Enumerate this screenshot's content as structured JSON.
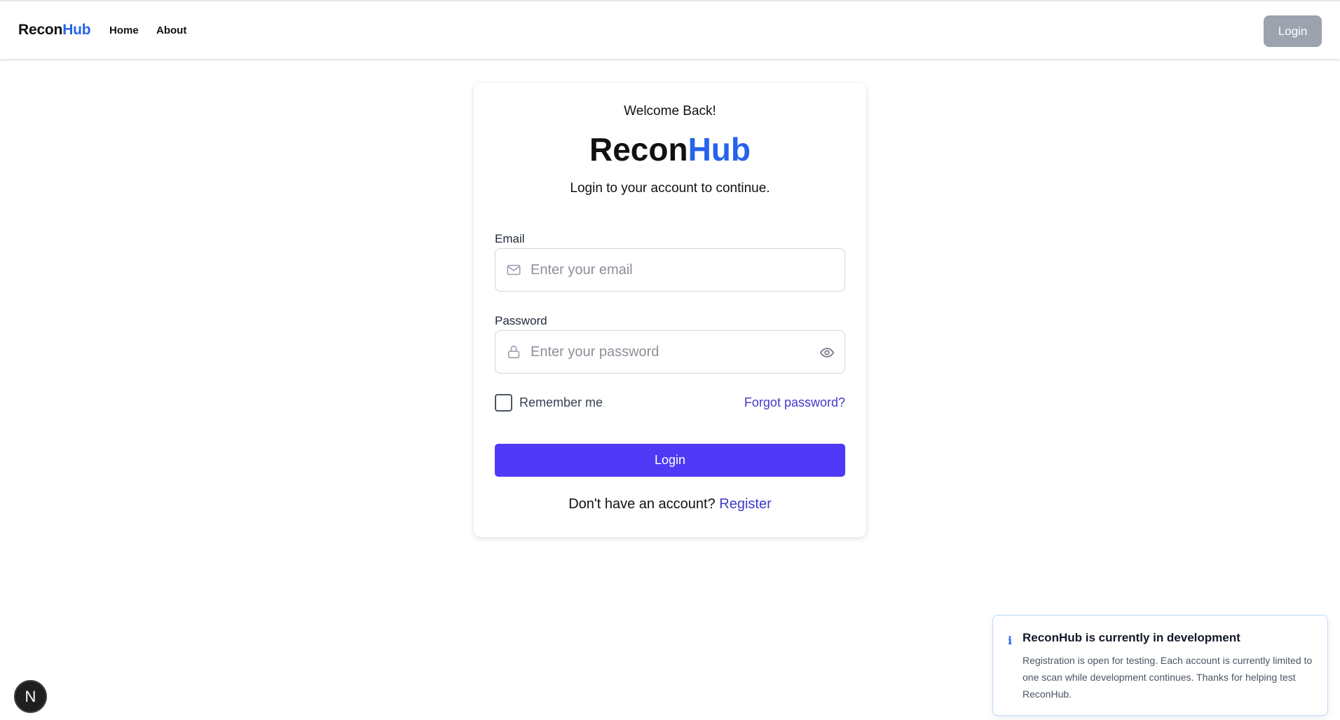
{
  "nav": {
    "brand_part1": "Recon",
    "brand_part2": "Hub",
    "links": [
      "Home",
      "About"
    ],
    "login_label": "Login"
  },
  "card": {
    "welcome": "Welcome Back!",
    "brand_part1": "Recon",
    "brand_part2": "Hub",
    "subtitle": "Login to your account to continue.",
    "email_label": "Email",
    "email_placeholder": "Enter your email",
    "password_label": "Password",
    "password_placeholder": "Enter your password",
    "remember_label": "Remember me",
    "remember_checked": false,
    "forgot_label": "Forgot password?",
    "login_label": "Login",
    "no_account_text": "Don't have an account?",
    "register_label": "Register"
  },
  "toast": {
    "icon": "info-icon",
    "icon_glyph": "i",
    "title": "ReconHub is currently in development",
    "body": "Registration is open for testing. Each account is currently limited to one scan while development continues. Thanks for helping test ReconHub."
  },
  "dev_badge": {
    "icon": "nextjs-logo-icon",
    "glyph": "N"
  },
  "colors": {
    "brand_accent": "#2563eb",
    "primary_button": "#4f39f6",
    "link": "#4338ca",
    "top_login_button": "#9ca3af"
  }
}
